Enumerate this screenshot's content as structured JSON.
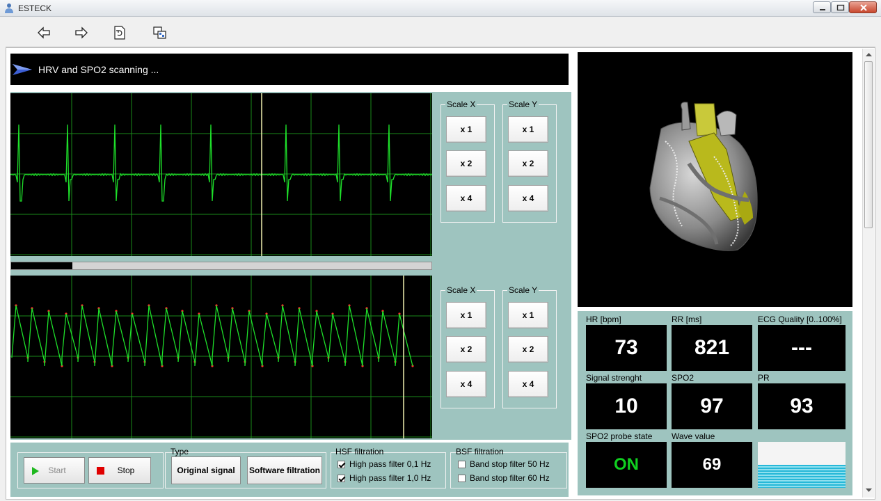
{
  "window": {
    "title": "ESTECK"
  },
  "toolbar": {
    "icons": [
      "back-arrow-icon",
      "forward-arrow-icon",
      "refresh-page-icon",
      "copy-window-icon"
    ]
  },
  "status": {
    "text": "HRV and SPO2 scanning ..."
  },
  "scale_top": {
    "x_label": "Scale X",
    "y_label": "Scale Y",
    "x_buttons": [
      "x 1",
      "x 2",
      "x 4"
    ],
    "y_buttons": [
      "x 1",
      "x 2",
      "x 4"
    ]
  },
  "scale_bottom": {
    "x_label": "Scale X",
    "y_label": "Scale Y",
    "x_buttons": [
      "x 1",
      "x 2",
      "x 4"
    ],
    "y_buttons": [
      "x 1",
      "x 2",
      "x 4"
    ]
  },
  "scan_progress": 0.145,
  "metrics": {
    "hr": {
      "label": "HR [bpm]",
      "value": "73"
    },
    "rr": {
      "label": "RR [ms]",
      "value": "821"
    },
    "ecg_quality": {
      "label": "ECG Quality [0..100%]",
      "value": "---"
    },
    "signal": {
      "label": "Signal strenght",
      "value": "10"
    },
    "spo2": {
      "label": "SPO2",
      "value": "97"
    },
    "pr": {
      "label": "PR",
      "value": "93"
    },
    "probe": {
      "label": "SPO2 probe state",
      "value": "ON"
    },
    "wave": {
      "label": "Wave value",
      "value": "69",
      "level": 0.5
    }
  },
  "controls": {
    "start_label": "Start",
    "stop_label": "Stop",
    "type_group": "Type",
    "original_label": "Original signal",
    "software_label": "Software filtration",
    "hsf_group": "HSF filtration",
    "hsf_items": [
      {
        "label": "High pass filter 0,1 Hz",
        "checked": true
      },
      {
        "label": "High pass filter 1,0 Hz",
        "checked": true
      }
    ],
    "bsf_group": "BSF filtration",
    "bsf_items": [
      {
        "label": "Band stop filter 50 Hz",
        "checked": false
      },
      {
        "label": "Band stop filter 60 Hz",
        "checked": false
      }
    ]
  },
  "colors": {
    "panel": "#9ec4bf",
    "trace": "#1ee02a",
    "peak_marker": "#ff2a2a",
    "cursor": "#f0f0b0"
  }
}
